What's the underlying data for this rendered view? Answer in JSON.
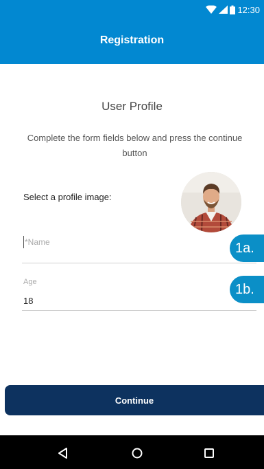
{
  "status_bar": {
    "time": "12:30",
    "icons": [
      "wifi-icon",
      "signal-icon",
      "battery-icon"
    ]
  },
  "app_bar": {
    "title": "Registration",
    "color": "#0288d1"
  },
  "form": {
    "title": "User Profile",
    "instructions": "Complete the form fields below and press the continue button",
    "profile_image_label": "Select a profile image:",
    "avatar": "profile-avatar-photo",
    "name_field": {
      "placeholder": "*Name",
      "value": ""
    },
    "age_field": {
      "label": "Age",
      "value": "18"
    }
  },
  "callouts": {
    "a": "1a.",
    "b": "1b.",
    "color": "#0b8fc7"
  },
  "actions": {
    "continue_label": "Continue",
    "color": "#0d325f"
  },
  "nav_bar": {
    "icons": [
      "back-triangle-icon",
      "home-circle-icon",
      "recents-square-icon"
    ]
  }
}
